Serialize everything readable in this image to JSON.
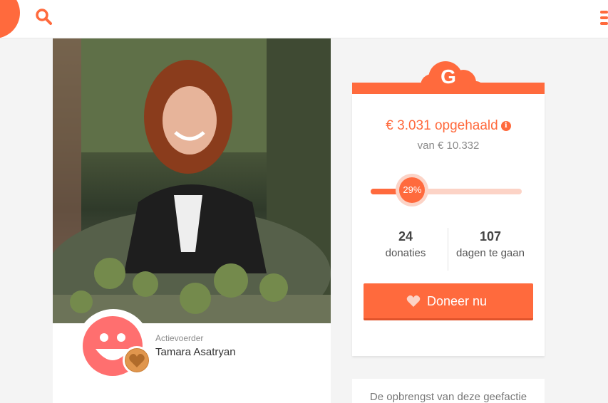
{
  "header": {
    "logo_icon": "brand-blob-icon",
    "search_icon": "search-icon",
    "menu_icon": "hamburger-menu-icon"
  },
  "campaign": {
    "photo_description_icon": "campaign-photo",
    "organizer": {
      "role": "Actievoerder",
      "name": "Tamara Asatryan",
      "avatar_icon": "smiley-avatar-icon",
      "badge_icon": "heart-badge-icon"
    }
  },
  "funding": {
    "category_letter": "G",
    "raised_text": "€ 3.031 opgehaald",
    "goal_text": "van € 10.332",
    "progress_percent": 29,
    "progress_label": "29%",
    "stats": [
      {
        "value": "24",
        "label": "donaties"
      },
      {
        "value": "107",
        "label": "dagen te gaan"
      }
    ],
    "donate_label": "Doneer nu"
  },
  "info": {
    "text": "De opbrengst van deze geefactie"
  },
  "colors": {
    "accent": "#ff6a3d",
    "accent_light": "#fcd3c6",
    "badge": "#e0964d"
  }
}
